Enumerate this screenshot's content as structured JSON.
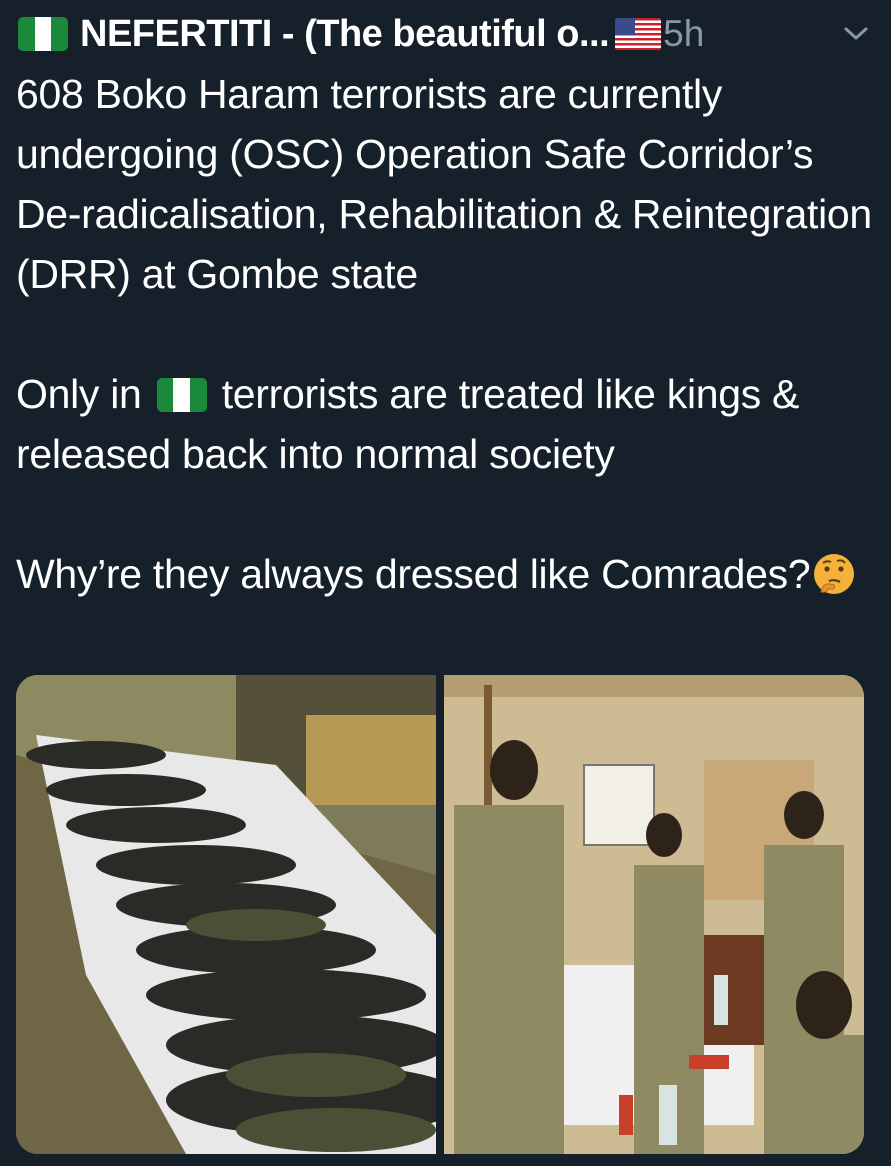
{
  "tweet": {
    "author_name": "NEFERTITI - (The beautiful o...",
    "author_flag": "nigeria-flag",
    "author_flag2": "us-flag",
    "timestamp": "5h",
    "menu_icon": "chevron-down-icon",
    "lines": {
      "p1": "608 Boko Haram terrorists are currently undergoing (OSC) Operation Safe Corridor’s De-radicalisation, Rehabilitation & Reintegration (DRR) at Gombe state",
      "p2_before": "Only in ",
      "p2_after": " terrorists are treated like kings & released back into normal society",
      "p3": "Why’re they always dressed like Comrades?"
    },
    "emoji_icon": "thinking-face-icon",
    "media": [
      {
        "name": "photo-bodies-on-ground"
      },
      {
        "name": "photo-men-in-uniform-at-table"
      }
    ]
  },
  "colors": {
    "background": "#15202b",
    "text": "#ffffff",
    "muted": "#8899a6",
    "nigeria_green": "#1a8a3a"
  }
}
